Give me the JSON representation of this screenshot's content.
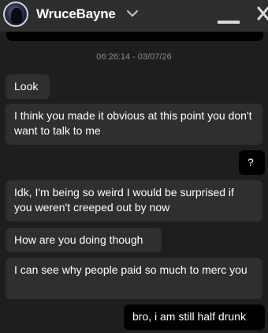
{
  "header": {
    "contact_name": "WruceBayne"
  },
  "conversation": {
    "timestamp": "06:26:14 - 03/07/26",
    "messages": [
      {
        "direction": "incoming",
        "text": "Look"
      },
      {
        "direction": "incoming",
        "text": "I think you made it obvious at this point you don't want to talk to me"
      },
      {
        "direction": "outgoing",
        "text": "?"
      },
      {
        "direction": "incoming",
        "text": "Idk, I'm being so weird I would be surprised if you weren't creeped out by now"
      },
      {
        "direction": "incoming",
        "text": "How are you doing though"
      },
      {
        "direction": "incoming",
        "text": "I can see why people paid so much to merc you"
      },
      {
        "direction": "outgoing",
        "text": "bro, i am still half drunk"
      }
    ]
  },
  "colors": {
    "background": "#1e1e1e",
    "header": "#2e2e2e",
    "incoming_bubble": "#2f2f2f",
    "outgoing_bubble": "#000000",
    "timestamp": "#8a8a8a"
  },
  "icons": {
    "dropdown": "chevron-down-icon",
    "minimize": "minimize-icon",
    "close": "close-icon"
  }
}
